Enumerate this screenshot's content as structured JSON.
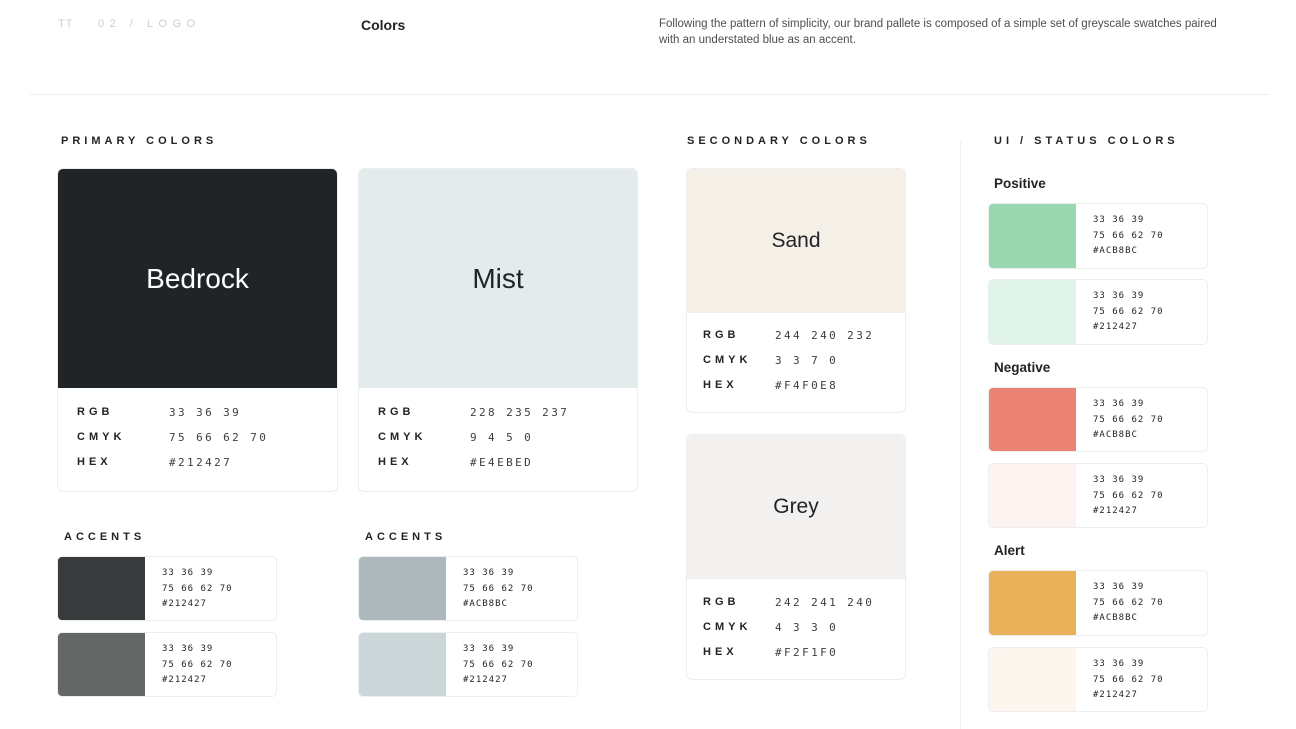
{
  "header": {
    "mark": "TT",
    "crumb": "02 / LOGO",
    "title": "Colors",
    "description": "Following the pattern of simplicity, our brand pallete is composed of a simple set of greyscale swatches paired with an understated blue as an accent."
  },
  "sections": {
    "primary_title": "PRIMARY COLORS",
    "secondary_title": "SECONDARY COLORS",
    "status_title": "UI / STATUS COLORS"
  },
  "spec_labels": {
    "rgb": "RGB",
    "cmyk": "CMYK",
    "hex": "HEX"
  },
  "primary": [
    {
      "name": "Bedrock",
      "color": "#212427",
      "text_color": "#ffffff",
      "rgb": "33 36 39",
      "cmyk": "75 66 62 70",
      "hex": "#212427"
    },
    {
      "name": "Mist",
      "color": "#E4EBED",
      "text_color": "#212427",
      "rgb": "228 235 237",
      "cmyk": "9 4 5 0",
      "hex": "#E4EBED"
    }
  ],
  "secondary": [
    {
      "name": "Sand",
      "color": "#F4F0E8",
      "rgb": "244 240 232",
      "cmyk": "3 3 7 0",
      "hex": "#F4F0E8"
    },
    {
      "name": "Grey",
      "color": "#F2F1F0",
      "rgb": "242 241 240",
      "cmyk": "4 3 3 0",
      "hex": "#F2F1F0"
    }
  ],
  "accents": [
    {
      "title": "ACCENTS",
      "items": [
        {
          "color": "#383B3C",
          "rgb": "33 36 39",
          "cmyk": "75 66 62 70",
          "hex": "#212427"
        },
        {
          "color": "#636766",
          "rgb": "33 36 39",
          "cmyk": "75 66 62 70",
          "hex": "#212427"
        }
      ]
    },
    {
      "title": "ACCENTS",
      "items": [
        {
          "color": "#ACB8BC",
          "rgb": "33 36 39",
          "cmyk": "75 66 62 70",
          "hex": "#ACB8BC"
        },
        {
          "color": "#CAD6D8",
          "rgb": "33 36 39",
          "cmyk": "75 66 62 70",
          "hex": "#212427"
        }
      ]
    }
  ],
  "status": [
    {
      "label": "Positive",
      "items": [
        {
          "color": "#98D7AF",
          "rgb": "33 36 39",
          "cmyk": "75 66 62 70",
          "hex": "#ACB8BC"
        },
        {
          "color": "#E0F3E8",
          "rgb": "33 36 39",
          "cmyk": "75 66 62 70",
          "hex": "#212427"
        }
      ]
    },
    {
      "label": "Negative",
      "items": [
        {
          "color": "#EA8373",
          "rgb": "33 36 39",
          "cmyk": "75 66 62 70",
          "hex": "#ACB8BC"
        },
        {
          "color": "#FDF3F0",
          "rgb": "33 36 39",
          "cmyk": "75 66 62 70",
          "hex": "#212427"
        }
      ]
    },
    {
      "label": "Alert",
      "items": [
        {
          "color": "#E9B15A",
          "rgb": "33 36 39",
          "cmyk": "75 66 62 70",
          "hex": "#ACB8BC"
        },
        {
          "color": "#FCF6EF",
          "rgb": "33 36 39",
          "cmyk": "75 66 62 70",
          "hex": "#212427"
        }
      ]
    }
  ]
}
